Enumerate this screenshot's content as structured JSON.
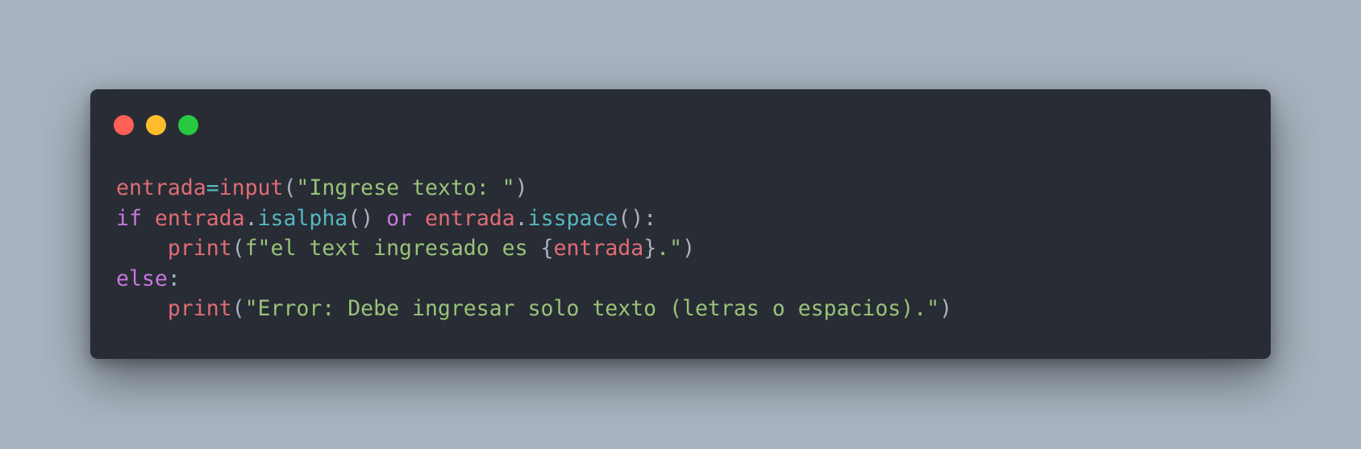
{
  "window": {
    "controls": [
      {
        "name": "close",
        "color": "#ff5f56"
      },
      {
        "name": "minimize",
        "color": "#ffbd2e"
      },
      {
        "name": "maximize",
        "color": "#27c93f"
      }
    ]
  },
  "code": {
    "language": "python",
    "lines": [
      [
        {
          "text": "entrada",
          "type": "var"
        },
        {
          "text": "=",
          "type": "op"
        },
        {
          "text": "input",
          "type": "fn"
        },
        {
          "text": "(",
          "type": "punc"
        },
        {
          "text": "\"Ingrese texto: \"",
          "type": "str"
        },
        {
          "text": ")",
          "type": "punc"
        }
      ],
      [
        {
          "text": "if",
          "type": "kw"
        },
        {
          "text": " ",
          "type": "punc"
        },
        {
          "text": "entrada",
          "type": "var"
        },
        {
          "text": ".",
          "type": "punc"
        },
        {
          "text": "isalpha",
          "type": "method"
        },
        {
          "text": "() ",
          "type": "punc"
        },
        {
          "text": "or",
          "type": "kw"
        },
        {
          "text": " ",
          "type": "punc"
        },
        {
          "text": "entrada",
          "type": "var"
        },
        {
          "text": ".",
          "type": "punc"
        },
        {
          "text": "isspace",
          "type": "method"
        },
        {
          "text": "():",
          "type": "punc"
        }
      ],
      [
        {
          "text": "    ",
          "type": "punc"
        },
        {
          "text": "print",
          "type": "fn"
        },
        {
          "text": "(",
          "type": "punc"
        },
        {
          "text": "f\"el text ingresado es ",
          "type": "str"
        },
        {
          "text": "{",
          "type": "punc"
        },
        {
          "text": "entrada",
          "type": "var"
        },
        {
          "text": "}",
          "type": "punc"
        },
        {
          "text": ".\"",
          "type": "str"
        },
        {
          "text": ")",
          "type": "punc"
        }
      ],
      [
        {
          "text": "else",
          "type": "kw"
        },
        {
          "text": ":",
          "type": "punc"
        }
      ],
      [
        {
          "text": "    ",
          "type": "punc"
        },
        {
          "text": "print",
          "type": "fn"
        },
        {
          "text": "(",
          "type": "punc"
        },
        {
          "text": "\"Error: Debe ingresar solo texto (letras o espacios).\"",
          "type": "str"
        },
        {
          "text": ")",
          "type": "punc"
        }
      ]
    ]
  }
}
